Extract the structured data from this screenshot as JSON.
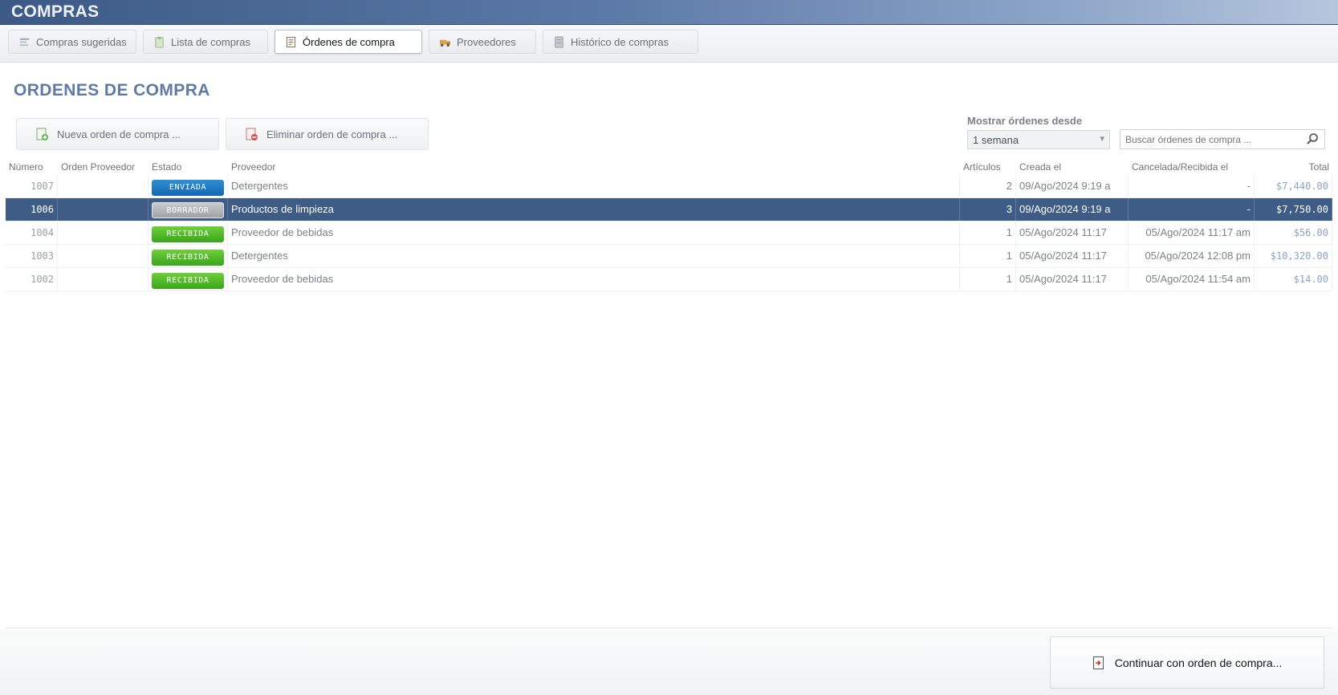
{
  "window": {
    "title": "COMPRAS"
  },
  "tabs": [
    {
      "label": "Compras sugeridas",
      "icon": "list-icon",
      "active": false
    },
    {
      "label": "Lista de compras",
      "icon": "clipboard-icon",
      "active": false
    },
    {
      "label": "Órdenes de compra",
      "icon": "document-icon",
      "active": true
    },
    {
      "label": "Proveedores",
      "icon": "truck-icon",
      "active": false
    },
    {
      "label": "Histórico de compras",
      "icon": "archive-icon",
      "active": false
    }
  ],
  "section_title": "ORDENES DE COMPRA",
  "toolbar": {
    "new_order": "Nueva orden de compra ...",
    "delete_order": "Eliminar orden de compra ...",
    "show_since_label": "Mostrar órdenes desde",
    "show_since_value": "1 semana",
    "search_placeholder": "Buscar órdenes de compra ..."
  },
  "table": {
    "columns": [
      "Número",
      "Orden Proveedor",
      "Estado",
      "Proveedor",
      "Artículos",
      "Creada el",
      "Cancelada/Recibida el",
      "Total"
    ],
    "rows": [
      {
        "numero": "1007",
        "orden": "",
        "estado": "ENVIADA",
        "estado_color": "#1a73bd",
        "proveedor": "Detergentes",
        "articulos": "2",
        "creada": "09/Ago/2024 9:19 a",
        "cancelada": "-",
        "total": "$7,440.00",
        "selected": false
      },
      {
        "numero": "1006",
        "orden": "",
        "estado": "BORRADOR",
        "estado_color": "#a9acb0",
        "proveedor": "Productos de limpieza",
        "articulos": "3",
        "creada": "09/Ago/2024 9:19 a",
        "cancelada": "-",
        "total": "$7,750.00",
        "selected": true
      },
      {
        "numero": "1004",
        "orden": "",
        "estado": "RECIBIDA",
        "estado_color": "#44ab22",
        "proveedor": "Proveedor de bebidas",
        "articulos": "1",
        "creada": "05/Ago/2024 11:17",
        "cancelada": "05/Ago/2024 11:17 am",
        "total": "$56.00",
        "selected": false
      },
      {
        "numero": "1003",
        "orden": "",
        "estado": "RECIBIDA",
        "estado_color": "#44ab22",
        "proveedor": "Detergentes",
        "articulos": "1",
        "creada": "05/Ago/2024 11:17",
        "cancelada": "05/Ago/2024 12:08 pm",
        "total": "$10,320.00",
        "selected": false
      },
      {
        "numero": "1002",
        "orden": "",
        "estado": "RECIBIDA",
        "estado_color": "#44ab22",
        "proveedor": "Proveedor de bebidas",
        "articulos": "1",
        "creada": "05/Ago/2024 11:17",
        "cancelada": "05/Ago/2024 11:54 am",
        "total": "$14.00",
        "selected": false
      }
    ]
  },
  "footer": {
    "continue_label": "Continuar con orden de compra..."
  }
}
